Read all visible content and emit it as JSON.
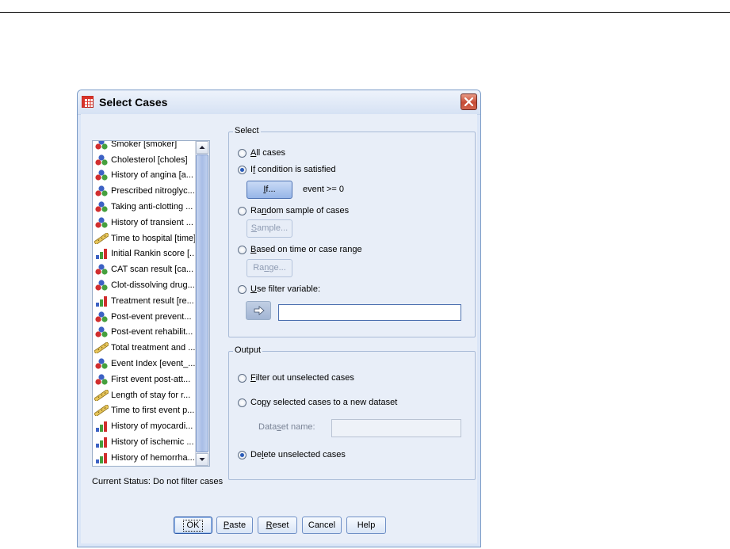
{
  "dialog": {
    "title": "Select Cases",
    "icons": {
      "title": "grid-table-icon",
      "close": "close-x-icon"
    }
  },
  "variables": [
    {
      "label": "Smoker [smoker]",
      "type": "nominal"
    },
    {
      "label": "Cholesterol [choles]",
      "type": "nominal"
    },
    {
      "label": "History of angina [a...",
      "type": "nominal"
    },
    {
      "label": "Prescribed nitroglyc...",
      "type": "nominal"
    },
    {
      "label": "Taking anti-clotting ...",
      "type": "nominal"
    },
    {
      "label": "History of transient ...",
      "type": "nominal"
    },
    {
      "label": "Time to hospital [time]",
      "type": "scale"
    },
    {
      "label": "Initial Rankin score [...",
      "type": "ordinal"
    },
    {
      "label": "CAT scan result [ca...",
      "type": "nominal"
    },
    {
      "label": "Clot-dissolving drug...",
      "type": "nominal"
    },
    {
      "label": "Treatment result [re...",
      "type": "ordinal"
    },
    {
      "label": "Post-event prevent...",
      "type": "nominal"
    },
    {
      "label": "Post-event rehabilit...",
      "type": "nominal"
    },
    {
      "label": "Total treatment and ...",
      "type": "scale"
    },
    {
      "label": "Event Index [event_...",
      "type": "nominal"
    },
    {
      "label": "First event post-att...",
      "type": "nominal"
    },
    {
      "label": "Length of stay for r...",
      "type": "scale"
    },
    {
      "label": "Time to first event p...",
      "type": "scale"
    },
    {
      "label": "History of myocardi...",
      "type": "ordinal"
    },
    {
      "label": "History of ischemic ...",
      "type": "ordinal"
    },
    {
      "label": "History of hemorrha...",
      "type": "ordinal"
    }
  ],
  "select": {
    "legend": "Select",
    "all_cases": {
      "mnemonic": "A",
      "rest": "ll cases",
      "checked": false
    },
    "if_condition": {
      "pre": "I",
      "mnemonic": "f",
      "rest": " condition is satisfied",
      "checked": true
    },
    "if_button": {
      "mnemonic": "I",
      "rest": "f..."
    },
    "condition_text": "event >= 0",
    "random_sample": {
      "pre": "Ra",
      "mnemonic": "n",
      "rest": "dom sample of cases",
      "checked": false
    },
    "sample_button": {
      "mnemonic": "S",
      "rest": "ample..."
    },
    "time_range": {
      "mnemonic": "B",
      "rest": "ased on time or case range",
      "checked": false
    },
    "range_button": {
      "pre": "Ra",
      "mnemonic": "n",
      "rest": "ge..."
    },
    "filter_var": {
      "mnemonic": "U",
      "rest": "se filter variable:",
      "checked": false
    },
    "filter_value": ""
  },
  "output": {
    "legend": "Output",
    "filter_out": {
      "mnemonic": "F",
      "rest": "ilter out unselected cases",
      "checked": false
    },
    "copy_to_dataset": {
      "pre": "Co",
      "mnemonic": "p",
      "rest": "y selected cases to a new dataset",
      "checked": false
    },
    "dataset_label": {
      "pre": "Data",
      "mnemonic": "s",
      "rest": "et name:"
    },
    "dataset_value": "",
    "delete_unselected": {
      "pre": "De",
      "mnemonic": "l",
      "rest": "ete unselected cases",
      "checked": true
    }
  },
  "status": "Current Status: Do not filter cases",
  "buttons": {
    "ok": "OK",
    "paste": {
      "mnemonic": "P",
      "rest": "aste"
    },
    "reset": {
      "mnemonic": "R",
      "rest": "eset"
    },
    "cancel": "Cancel",
    "help": "Help"
  }
}
